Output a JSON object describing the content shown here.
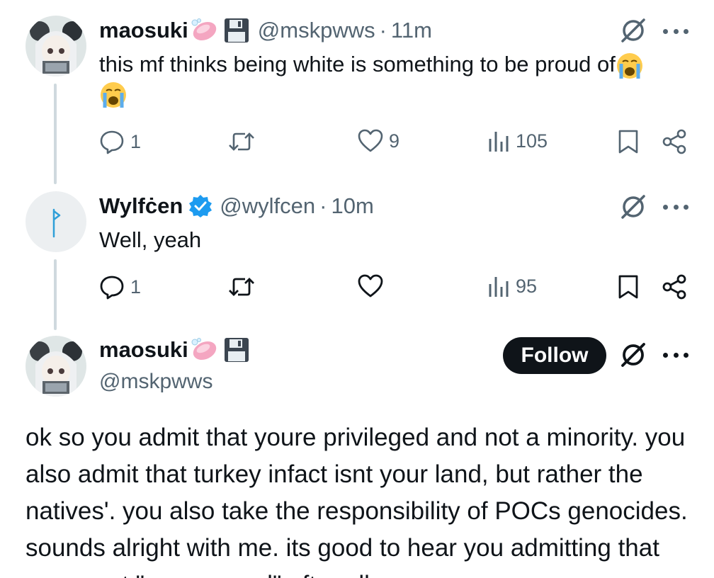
{
  "tweets": [
    {
      "display_name": "maosuki",
      "handle": "@mskpwws",
      "separator": "·",
      "time": "11m",
      "text_line1": "this mf thinks being white is something to be proud of",
      "stats": {
        "replies": "1",
        "reposts": "",
        "likes": "9",
        "views": "105"
      }
    },
    {
      "display_name": "Wylfċen",
      "handle": "@wylfcen",
      "separator": "·",
      "time": "10m",
      "text": "Well, yeah",
      "stats": {
        "replies": "1",
        "reposts": "",
        "likes": "",
        "views": "95"
      }
    }
  ],
  "main_tweet": {
    "display_name": "maosuki",
    "handle": "@mskpwws",
    "follow_label": "Follow",
    "text": "ok so you admit that youre privileged and not a minority. you also admit that turkey infact isnt your land, but rather the natives'. you also take the responsibility of POCs genocides. sounds alright with me. its good to hear you admitting that youre not \"suppressed\" after all"
  },
  "colors": {
    "text": "#0f1419",
    "secondary": "#536471",
    "thread_line": "#cfd9de",
    "verified": "#1d9bf0",
    "follow_bg": "#0f1419"
  },
  "icons": [
    "reply-icon",
    "repost-icon",
    "like-icon",
    "views-icon",
    "bookmark-icon",
    "share-icon",
    "grok-icon",
    "more-icon",
    "verified-badge-icon",
    "soap-emoji",
    "floppy-disk-emoji",
    "crying-face-emoji"
  ]
}
